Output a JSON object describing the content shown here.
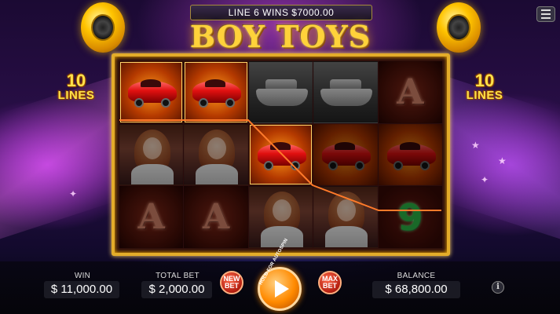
{
  "banner": {
    "win_text": "LINE 6 WINS $7000.00"
  },
  "logo": {
    "text": "BOY TOYS"
  },
  "lines_badge": {
    "number": "10",
    "word": "LINES"
  },
  "reels": [
    [
      {
        "symbol": "car",
        "state": "lit"
      },
      {
        "symbol": "car",
        "state": "lit"
      },
      {
        "symbol": "yacht",
        "state": "dim"
      },
      {
        "symbol": "yacht",
        "state": "dim"
      },
      {
        "symbol": "A",
        "state": "dim"
      }
    ],
    [
      {
        "symbol": "girl",
        "state": "dim"
      },
      {
        "symbol": "girl",
        "state": "dim"
      },
      {
        "symbol": "car",
        "state": "lit"
      },
      {
        "symbol": "car",
        "state": "dim"
      },
      {
        "symbol": "car",
        "state": "dim"
      }
    ],
    [
      {
        "symbol": "A",
        "state": "dim"
      },
      {
        "symbol": "A",
        "state": "dim"
      },
      {
        "symbol": "girl",
        "state": "dim"
      },
      {
        "symbol": "girl",
        "state": "dim"
      },
      {
        "symbol": "9",
        "state": "dim"
      }
    ]
  ],
  "bottom": {
    "win_label": "WIN",
    "win_value": "$ 11,000.00",
    "total_bet_label": "TOTAL BET",
    "total_bet_value": "$ 2,000.00",
    "new_bet_label": "NEW BET",
    "spin_hint": "HOLD FOR AUTOSPIN",
    "max_bet_label": "MAX BET",
    "balance_label": "BALANCE",
    "balance_value": "$ 68,800.00",
    "info_label": "i"
  },
  "colors": {
    "gold": "#e3ac2a",
    "logo": "#ffd23a",
    "spin": "#ff8a00",
    "bet_red": "#b31e10"
  }
}
